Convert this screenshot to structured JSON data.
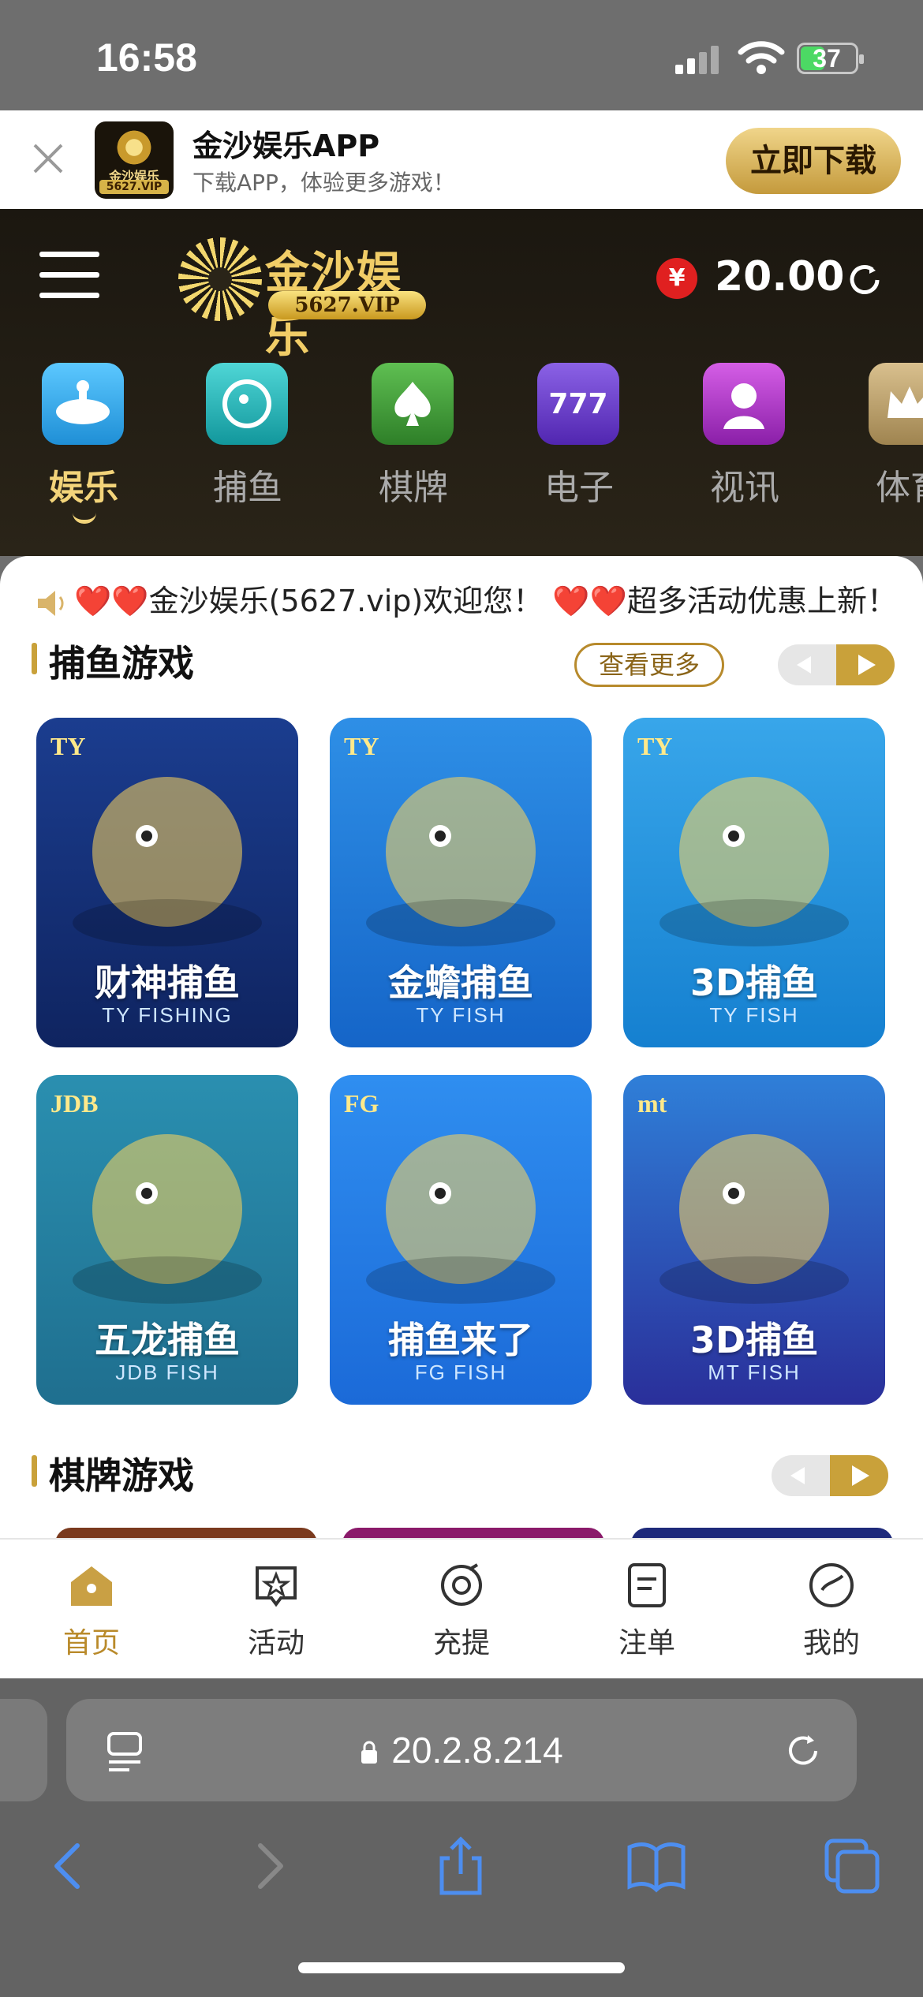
{
  "status_bar": {
    "time": "16:58",
    "battery": "37"
  },
  "app_banner": {
    "logo_text": "金沙娱乐",
    "logo_vip": "5627.VIP",
    "title": "金沙娱乐APP",
    "subtitle": "下载APP，体验更多游戏！",
    "download_label": "立即下载"
  },
  "header": {
    "brand_name": "金沙娱乐",
    "brand_vip": "5627.VIP",
    "currency_symbol": "¥",
    "balance": "20.00"
  },
  "categories": [
    {
      "label": "娱乐",
      "icon": "roulette-icon",
      "color": "#2aa7e6",
      "active": true
    },
    {
      "label": "捕鱼",
      "icon": "fish-icon",
      "color": "#1cb3b8"
    },
    {
      "label": "棋牌",
      "icon": "spade-icon",
      "color": "#3e9a3a"
    },
    {
      "label": "电子",
      "icon": "slot-777-icon",
      "color": "#6b3fc9"
    },
    {
      "label": "视讯",
      "icon": "live-dealer-icon",
      "color": "#b53fc9"
    },
    {
      "label": "体育",
      "icon": "crown-icon",
      "color": "#b8a070"
    }
  ],
  "marquee": "❤️❤️金沙娱乐(5627.vip)欢迎您！ ❤️❤️超多活动优惠上新！",
  "fishing_section": {
    "title": "捕鱼游戏",
    "more_label": "查看更多",
    "games": [
      {
        "provider": "TY",
        "name": "财神捕鱼",
        "sub": "TY FISHING",
        "colors": [
          "#1b3d8f",
          "#0f2460"
        ]
      },
      {
        "provider": "TY",
        "name": "金蟾捕鱼",
        "sub": "TY FISH",
        "colors": [
          "#2e8fe6",
          "#1565c8"
        ]
      },
      {
        "provider": "TY",
        "name": "3D捕鱼",
        "sub": "TY FISH",
        "colors": [
          "#38a6ea",
          "#1580d0"
        ]
      },
      {
        "provider": "JDB",
        "name": "五龙捕鱼",
        "sub": "JDB FISH",
        "colors": [
          "#2a8fb0",
          "#1f6f8f"
        ]
      },
      {
        "provider": "FG",
        "name": "捕鱼来了",
        "sub": "FG FISH",
        "colors": [
          "#2f8ef0",
          "#1b6ad8"
        ]
      },
      {
        "provider": "mt",
        "name": "3D捕鱼",
        "sub": "MT FISH",
        "colors": [
          "#2f7fd8",
          "#2a2f9a"
        ]
      }
    ]
  },
  "card_section": {
    "title": "棋牌游戏"
  },
  "tabbar": [
    {
      "label": "首页",
      "icon": "home-icon",
      "active": true
    },
    {
      "label": "活动",
      "icon": "promotions-star-icon"
    },
    {
      "label": "充提",
      "icon": "deposit-withdraw-icon"
    },
    {
      "label": "注单",
      "icon": "bet-record-icon"
    },
    {
      "label": "我的",
      "icon": "profile-icon"
    }
  ],
  "browser": {
    "url": "20.2.8.214"
  }
}
